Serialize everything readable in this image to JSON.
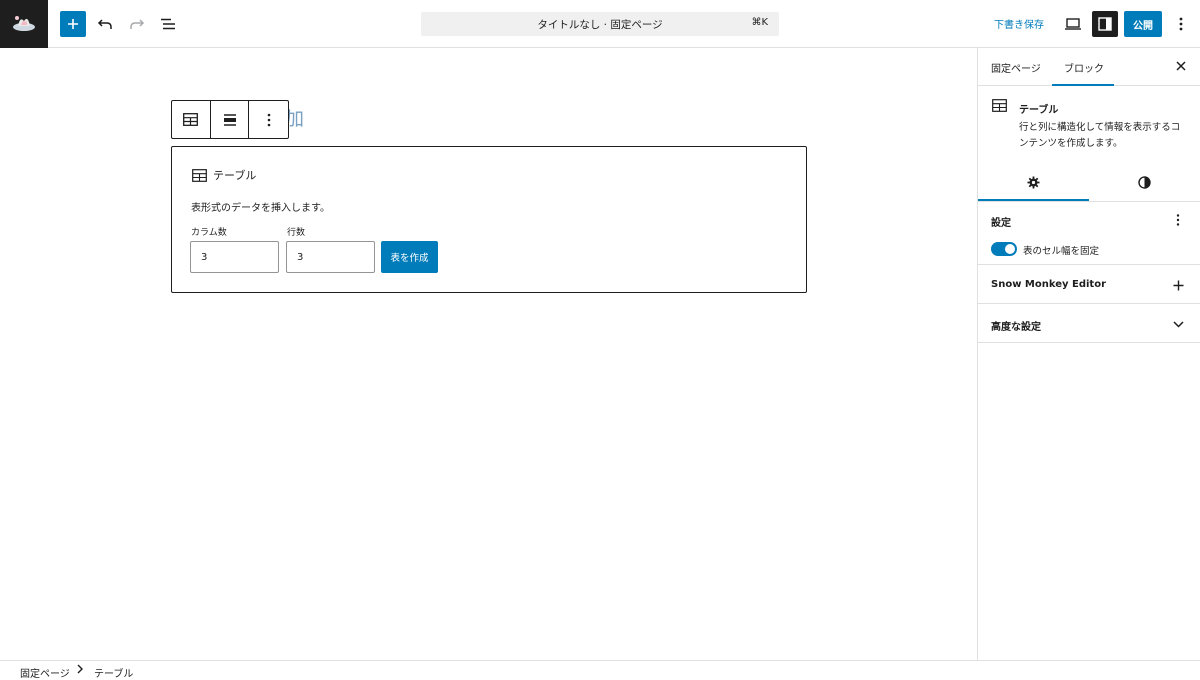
{
  "header": {
    "add_icon": "plus-icon",
    "undo_icon": "undo-icon",
    "redo_icon": "redo-icon",
    "list_view_icon": "list-view-icon",
    "command_label": "タイトルなし · 固定ページ",
    "command_shortcut": "⌘K",
    "save_draft": "下書き保存",
    "publish": "公開",
    "accent_color": "#007cba"
  },
  "canvas": {
    "title_placeholder_visible": "加",
    "table_block": {
      "title": "テーブル",
      "description": "表形式のデータを挿入します。",
      "columns_label": "カラム数",
      "columns_value": "3",
      "rows_label": "行数",
      "rows_value": "3",
      "create_button": "表を作成"
    }
  },
  "sidebar": {
    "tabs": [
      "固定ページ",
      "ブロック"
    ],
    "active_tab": "ブロック",
    "block_card": {
      "title": "テーブル",
      "description": "行と列に構造化して情報を表示するコンテンツを作成します。"
    },
    "settings_panel": {
      "title": "設定",
      "toggle_label": "表のセル幅を固定",
      "toggle_on": true
    },
    "snow_monkey_panel": {
      "title": "Snow Monkey Editor"
    },
    "advanced_panel": {
      "title": "高度な設定"
    }
  },
  "footer": {
    "breadcrumb": [
      "固定ページ",
      "テーブル"
    ]
  }
}
